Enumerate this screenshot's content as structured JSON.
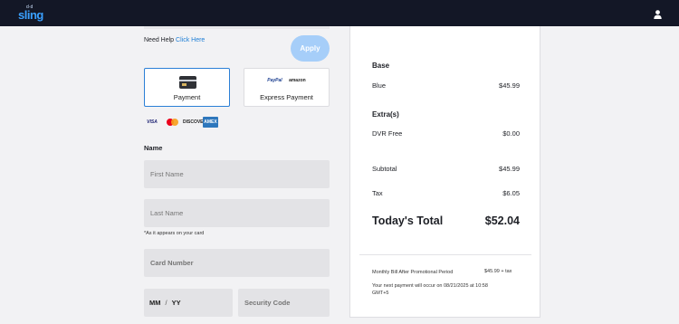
{
  "header": {
    "logo_small": "d·d",
    "logo_word": "sling"
  },
  "left": {
    "help_prefix": "Need Help",
    "help_link": "Click Here",
    "apply_label": "Apply",
    "methods": [
      {
        "label": "Payment"
      },
      {
        "label": "Express Payment",
        "wallets": [
          "PayPal",
          "amazon"
        ]
      }
    ],
    "brands": [
      "VISA",
      "DISCOVER",
      "AMEX"
    ],
    "name_section": "Name",
    "first_name_placeholder": "First Name",
    "last_name_placeholder": "Last Name",
    "name_hint": "*As it appears on your card",
    "card_number_placeholder": "Card Number",
    "mm": "MM",
    "slash": "/",
    "yy": "YY",
    "security_code_placeholder": "Security Code"
  },
  "summary": {
    "base_heading": "Base",
    "base_item": {
      "label": "Blue",
      "value": "$45.99"
    },
    "extras_heading": "Extra(s)",
    "extra_item": {
      "label": "DVR Free",
      "value": "$0.00"
    },
    "subtotal": {
      "label": "Subtotal",
      "value": "$45.99"
    },
    "tax": {
      "label": "Tax",
      "value": "$6.05"
    },
    "total": {
      "label": "Today's Total",
      "value": "$52.04"
    },
    "monthly_label": "Monthly Bill After Promotional Period",
    "monthly_value": "$45.99 + tax",
    "next_payment_line1": "Your next payment will occur on 08/21/2025 at 10:58",
    "next_payment_line2": "GMT+5"
  },
  "colors": {
    "topbar": "#131726",
    "accent": "#2b7fd6",
    "apply_disabled": "#a6cef9",
    "field_bg": "#e3e3e6"
  }
}
